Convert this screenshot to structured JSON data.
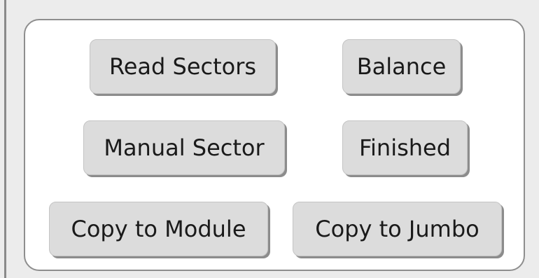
{
  "buttons": {
    "read_sectors": "Read Sectors",
    "balance": "Balance",
    "manual_sector": "Manual Sector",
    "finished": "Finished",
    "copy_to_module": "Copy to Module",
    "copy_to_jumbo": "Copy to Jumbo"
  }
}
